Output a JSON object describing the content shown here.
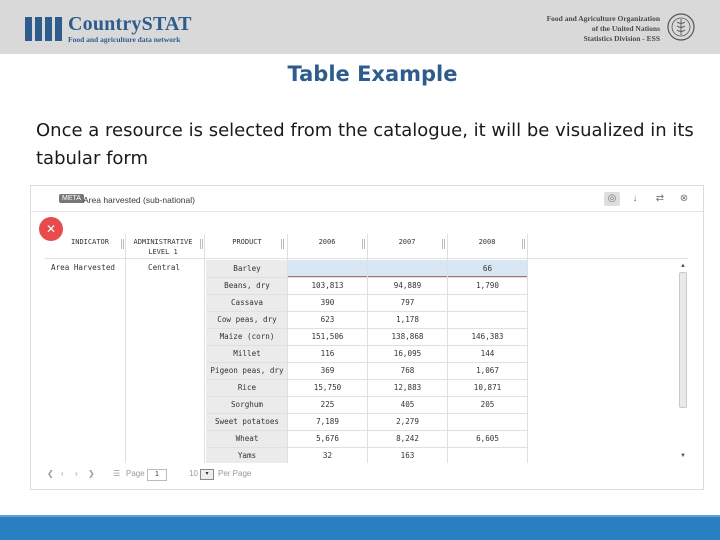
{
  "header": {
    "brand": "CountrySTAT",
    "tagline": "Food and agriculture data network",
    "org_lines": [
      "Food and Agriculture Organization",
      "of the United Nations",
      "Statistics Division - ESS"
    ],
    "brand_color": "#2e5d8d"
  },
  "slide": {
    "title": "Table Example",
    "description": "Once a resource is selected from the catalogue, it will be visualized in its tabular form"
  },
  "viewer": {
    "meta_label": "META",
    "resource_title": "Area harvested (sub-national)",
    "tool_icons": [
      "target-icon",
      "download-icon",
      "refresh-icon",
      "close-icon"
    ],
    "action_icon": "wrench-icon",
    "accent_red": "#e74b4b"
  },
  "table": {
    "headers": [
      "INDICATOR",
      "ADMINISTRATIVE LEVEL 1",
      "PRODUCT",
      "2006",
      "2007",
      "2008"
    ],
    "indicator": "Area Harvested",
    "admin_level": "Central",
    "rows": [
      {
        "product": "Barley",
        "y2006": "",
        "y2007": "",
        "y2008": "66"
      },
      {
        "product": "Beans, dry",
        "y2006": "103,813",
        "y2007": "94,889",
        "y2008": "1,790"
      },
      {
        "product": "Cassava",
        "y2006": "390",
        "y2007": "797",
        "y2008": ""
      },
      {
        "product": "Cow peas, dry",
        "y2006": "623",
        "y2007": "1,178",
        "y2008": ""
      },
      {
        "product": "Maize (corn)",
        "y2006": "151,506",
        "y2007": "138,868",
        "y2008": "146,383"
      },
      {
        "product": "Millet",
        "y2006": "116",
        "y2007": "16,095",
        "y2008": "144"
      },
      {
        "product": "Pigeon peas, dry",
        "y2006": "369",
        "y2007": "768",
        "y2008": "1,067"
      },
      {
        "product": "Rice",
        "y2006": "15,750",
        "y2007": "12,883",
        "y2008": "10,871"
      },
      {
        "product": "Sorghum",
        "y2006": "225",
        "y2007": "405",
        "y2008": "205"
      },
      {
        "product": "Sweet potatoes",
        "y2006": "7,189",
        "y2007": "2,279",
        "y2008": ""
      },
      {
        "product": "Wheat",
        "y2006": "5,676",
        "y2007": "8,242",
        "y2008": "6,605"
      },
      {
        "product": "Yams",
        "y2006": "32",
        "y2007": "163",
        "y2008": ""
      }
    ]
  },
  "pager": {
    "page_label": "Page",
    "page_value": "1",
    "per_page_value": "10",
    "per_page_label": "Per Page"
  }
}
